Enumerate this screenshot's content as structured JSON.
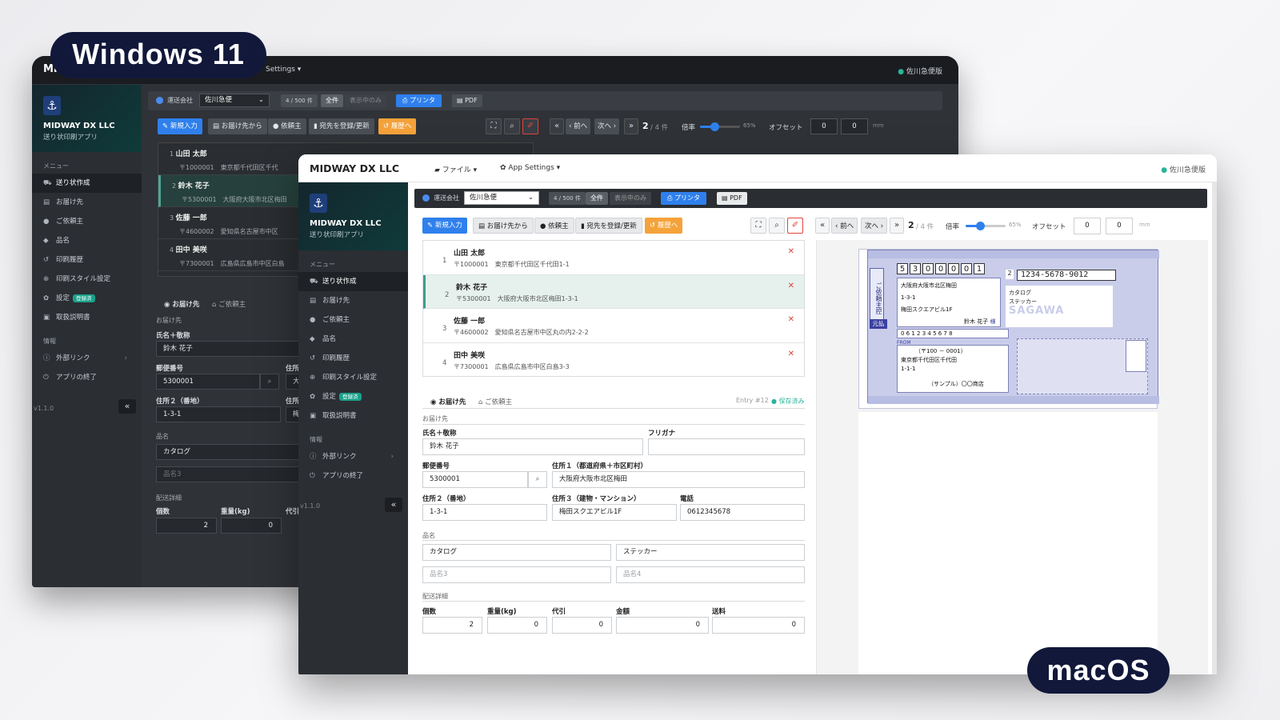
{
  "badges": {
    "windows": "Windows 11",
    "macos": "macOS"
  },
  "app": {
    "name": "MIDWAY DX LLC",
    "subtitle": "送り状印刷アプリ",
    "version": "v1.1.0",
    "menu_file": "ファイル",
    "menu_settings": "App Settings",
    "menu_settings_win": "Settings",
    "carrier_status": "佐川急便版",
    "win_title_fragment": "MI"
  },
  "sidebar": {
    "section_menu": "メニュー",
    "section_info": "情報",
    "items": [
      {
        "label": "送り状作成",
        "icon": "truck-icon",
        "active": true
      },
      {
        "label": "お届け先",
        "icon": "address-book-icon"
      },
      {
        "label": "ご依頼主",
        "icon": "user-icon"
      },
      {
        "label": "品名",
        "icon": "tag-icon"
      },
      {
        "label": "印刷履歴",
        "icon": "history-icon"
      },
      {
        "label": "印刷スタイル設定",
        "icon": "crosshair-icon"
      },
      {
        "label": "設定",
        "icon": "gear-icon",
        "tag": "登録済"
      },
      {
        "label": "取扱説明書",
        "icon": "book-icon"
      }
    ],
    "info_items": [
      {
        "label": "外部リンク",
        "icon": "info-icon"
      },
      {
        "label": "アプリの終了",
        "icon": "power-icon"
      }
    ],
    "collapse": "«"
  },
  "toolbar": {
    "carrier_label": "運送会社",
    "carrier_value": "佐川急便",
    "count": "4 / 500 件",
    "all": "全件",
    "shown_only": "表示中のみ",
    "printer": "プリンタ",
    "pdf": "PDF"
  },
  "actions": {
    "new": "新規入力",
    "from_dest": "お届け先から",
    "sender": "依頼主",
    "register": "宛先を登録/更新",
    "history": "履歴へ"
  },
  "pager": {
    "first": "«",
    "prev": "‹ 前へ",
    "next": "次へ ›",
    "last": "»",
    "current": "2",
    "total": "/ 4 件",
    "zoom_label": "倍率",
    "zoom_value": "65%",
    "zoom_fraction": 0.65,
    "offset_label": "オフセット",
    "offset_x": "0",
    "offset_y": "0",
    "unit": "mm"
  },
  "entries": [
    {
      "num": "1",
      "name": "山田 太郎",
      "address": "〒1000001　東京都千代田区千代田1-1",
      "address_win": "〒1000001　東京都千代田区千代"
    },
    {
      "num": "2",
      "name": "鈴木 花子",
      "address": "〒5300001　大阪府大阪市北区梅田1-3-1",
      "address_win": "〒5300001　大阪府大阪市北区梅田",
      "selected": true
    },
    {
      "num": "3",
      "name": "佐藤 一郎",
      "address": "〒4600002　愛知県名古屋市中区丸の内2-2-2",
      "address_win": "〒4600002　愛知県名古屋市中区"
    },
    {
      "num": "4",
      "name": "田中 美咲",
      "address": "〒7300001　広島県広島市中区白島3-3",
      "address_win": "〒7300001　広島県広島市中区白島"
    }
  ],
  "form": {
    "tab_dest": "お届け先",
    "tab_sender": "ご依頼主",
    "entry_no": "Entry #12",
    "saved": "保存済み",
    "section_dest": "お届け先",
    "name_label": "氏名＋敬称",
    "name_value": "鈴木 花子",
    "kana_label": "フリガナ",
    "kana_value": "",
    "zip_label": "郵便番号",
    "zip_value": "5300001",
    "addr1_label": "住所１（都道府県＋市区町村）",
    "addr1_label_win": "住所",
    "addr1_value": "大阪府大阪市北区梅田",
    "addr1_value_win": "大",
    "addr2_label": "住所２（番地）",
    "addr2_value": "1-3-1",
    "addr3_label": "住所３（建物・マンション）",
    "addr3_label_win": "住所",
    "addr3_value": "梅田スクエアビル1F",
    "addr3_value_win": "梅",
    "phone_label": "電話",
    "phone_value": "0612345678",
    "section_item": "品名",
    "item1": "カタログ",
    "item2": "ステッカー",
    "item3_placeholder": "品名3",
    "item4_placeholder": "品名4",
    "section_ship": "配送詳細",
    "qty_label": "個数",
    "qty_value": "2",
    "weight_label": "重量(kg)",
    "weight_value": "0",
    "cod_label": "代引",
    "cod_label_win": "代引",
    "cod_value": "0",
    "amount_label": "金額",
    "amount_value": "0",
    "fee_label": "送料",
    "fee_value": "0"
  },
  "label_preview": {
    "zip": [
      "5",
      "3",
      "0",
      "0",
      "0",
      "0",
      "1"
    ],
    "tracking": "1234-5678-9012",
    "count_value": "2",
    "addr_line1": "大阪府大阪市北区梅田",
    "addr_line2": "1-3-1",
    "addr_line3": "梅田スクエアビル1F",
    "recipient": "鈴木 花子",
    "honorific": "様",
    "tel": "0 6    1 2 3 4 5 6 7 8",
    "item1": "カタログ",
    "item2": "ステッカー",
    "sender_zip": "（〒100 － 0001）",
    "sender_addr1": "東京都千代田区千代田",
    "sender_addr2": "1-1-1",
    "sender_name": "（サンプル）〇〇商店",
    "prepaid": "元払",
    "from_label": "FROM",
    "sidebar_text": "ご依頼主控",
    "company_watermark": "SAGAWA"
  }
}
